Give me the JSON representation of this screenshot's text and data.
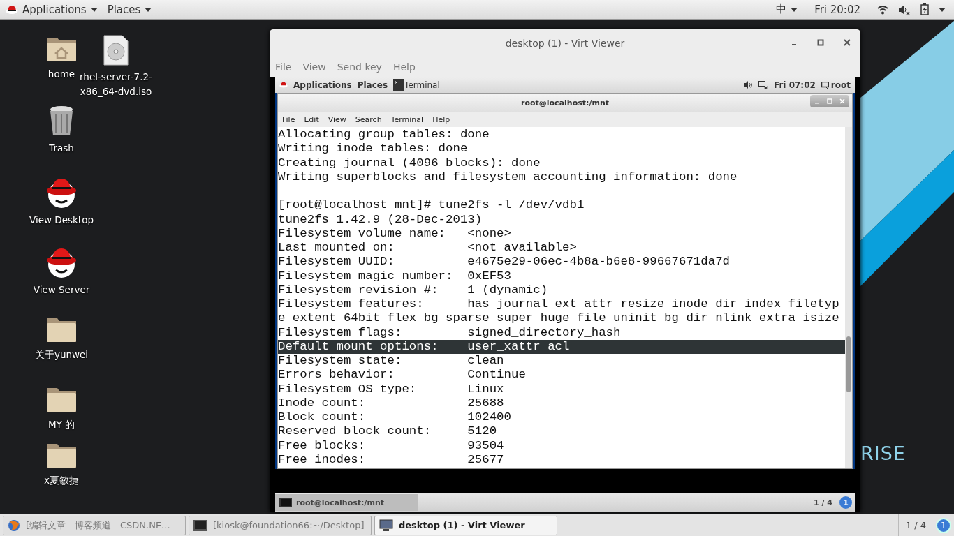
{
  "top_bar": {
    "applications_menu": "Applications",
    "places_menu": "Places",
    "input_method": "中",
    "clock": "Fri 20:02"
  },
  "desktop_icons": [
    {
      "label": "home",
      "kind": "home"
    },
    {
      "label": "rhel-server-7.2-x86_64-dvd.iso",
      "kind": "disc"
    },
    {
      "label": "Trash",
      "kind": "trash"
    },
    {
      "label": "View Desktop",
      "kind": "redhat"
    },
    {
      "label": "View Server",
      "kind": "redhat"
    },
    {
      "label": "关于yunwei",
      "kind": "folder"
    },
    {
      "label": "MY 的",
      "kind": "folder"
    },
    {
      "label": "x夏敏捷",
      "kind": "folder"
    }
  ],
  "wallpaper_text": "RISE",
  "viewer": {
    "title": "desktop (1) - Virt Viewer",
    "menu": [
      "File",
      "View",
      "Send key",
      "Help"
    ],
    "guest": {
      "top_bar": {
        "applications_menu": "Applications",
        "places_menu": "Places",
        "task": "Terminal",
        "clock": "Fri 07:02",
        "user": "root"
      },
      "terminal": {
        "title": "root@localhost:/mnt",
        "menu": [
          "File",
          "Edit",
          "View",
          "Search",
          "Terminal",
          "Help"
        ],
        "blocks": [
          {
            "lines": [
              {
                "text": "Allocating group tables: done",
                "selected": false
              },
              {
                "text": "Writing inode tables: done",
                "selected": false
              },
              {
                "text": "Creating journal (4096 blocks): done",
                "selected": false
              },
              {
                "text": "Writing superblocks and filesystem accounting information: done",
                "selected": false
              }
            ]
          },
          {
            "lines": [
              {
                "text": "[root@localhost mnt]# tune2fs -l /dev/vdb1",
                "selected": false
              },
              {
                "text": "tune2fs 1.42.9 (28-Dec-2013)",
                "selected": false
              },
              {
                "text": "Filesystem volume name:   <none>",
                "selected": false
              },
              {
                "text": "Last mounted on:          <not available>",
                "selected": false
              },
              {
                "text": "Filesystem UUID:          e4675e29-06ec-4b8a-b6e8-99667671da7d",
                "selected": false
              },
              {
                "text": "Filesystem magic number:  0xEF53",
                "selected": false
              },
              {
                "text": "Filesystem revision #:    1 (dynamic)",
                "selected": false
              },
              {
                "text": "Filesystem features:      has_journal ext_attr resize_inode dir_index filetyp",
                "selected": false
              },
              {
                "text": "e extent 64bit flex_bg sparse_super huge_file uninit_bg dir_nlink extra_isize",
                "selected": false
              },
              {
                "text": "Filesystem flags:         signed_directory_hash",
                "selected": false
              },
              {
                "text": "Default mount options:    user_xattr acl",
                "selected": true
              },
              {
                "text": "Filesystem state:         clean",
                "selected": false
              },
              {
                "text": "Errors behavior:          Continue",
                "selected": false
              },
              {
                "text": "Filesystem OS type:       Linux",
                "selected": false
              },
              {
                "text": "Inode count:              25688",
                "selected": false
              },
              {
                "text": "Block count:              102400",
                "selected": false
              },
              {
                "text": "Reserved block count:     5120",
                "selected": false
              },
              {
                "text": "Free blocks:              93504",
                "selected": false
              },
              {
                "text": "Free inodes:              25677",
                "selected": false
              }
            ]
          }
        ]
      },
      "bottom_panel": {
        "task": "root@localhost:/mnt",
        "workspace": "1 / 4",
        "badge": "1"
      }
    }
  },
  "taskbar": {
    "tasks": [
      {
        "label": "[编辑文章 - 博客频道 - CSDN.NE...",
        "kind": "browser",
        "selected": false
      },
      {
        "label": "[kiosk@foundation66:~/Desktop]",
        "kind": "terminal",
        "selected": false
      },
      {
        "label": "desktop (1) - Virt Viewer",
        "kind": "monitor",
        "selected": true
      }
    ],
    "workspace": "1 / 4",
    "badge": "1"
  }
}
